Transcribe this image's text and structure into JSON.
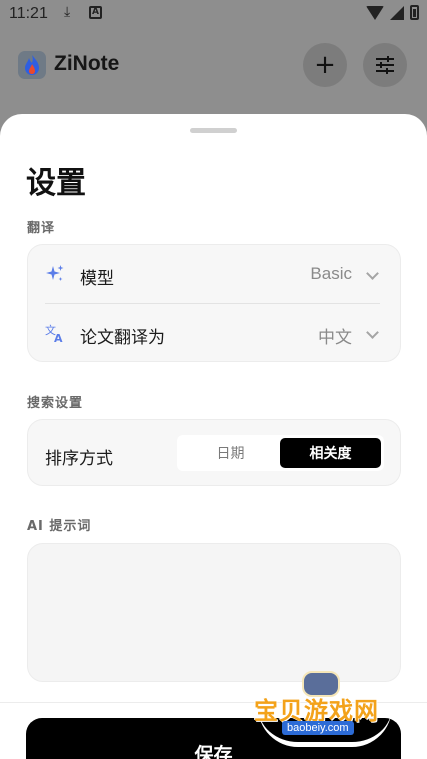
{
  "status_bar": {
    "time": "11:21",
    "icons": [
      "download-icon",
      "app-notification-icon",
      "wifi-icon",
      "cell-signal-icon",
      "battery-icon"
    ]
  },
  "app_bar": {
    "title": "ZiNote",
    "logo_icon": "flame-logo",
    "add_icon_glyph": "+",
    "filter_icon_name": "sliders-icon"
  },
  "sheet": {
    "title": "设置",
    "translation": {
      "section_label": "翻译",
      "model": {
        "label": "模型",
        "value": "Basic",
        "icon": "sparkle-icon"
      },
      "paper_translate": {
        "label": "论文翻译为",
        "value": "中文",
        "icon": "translate-icon"
      }
    },
    "search": {
      "section_label": "搜索设置",
      "sort_label": "排序方式",
      "options": [
        "日期",
        "相关度"
      ],
      "selected": "相关度"
    },
    "ai_prompt": {
      "section_label": "AI 提示词",
      "value": ""
    },
    "save_label": "保存"
  },
  "watermark": {
    "text": "宝贝游戏网",
    "url": "baobeiy.com"
  },
  "colors": {
    "accent_icon": "#5b7de8",
    "primary_button": "#000000",
    "overlay": "#8e8e8e"
  }
}
